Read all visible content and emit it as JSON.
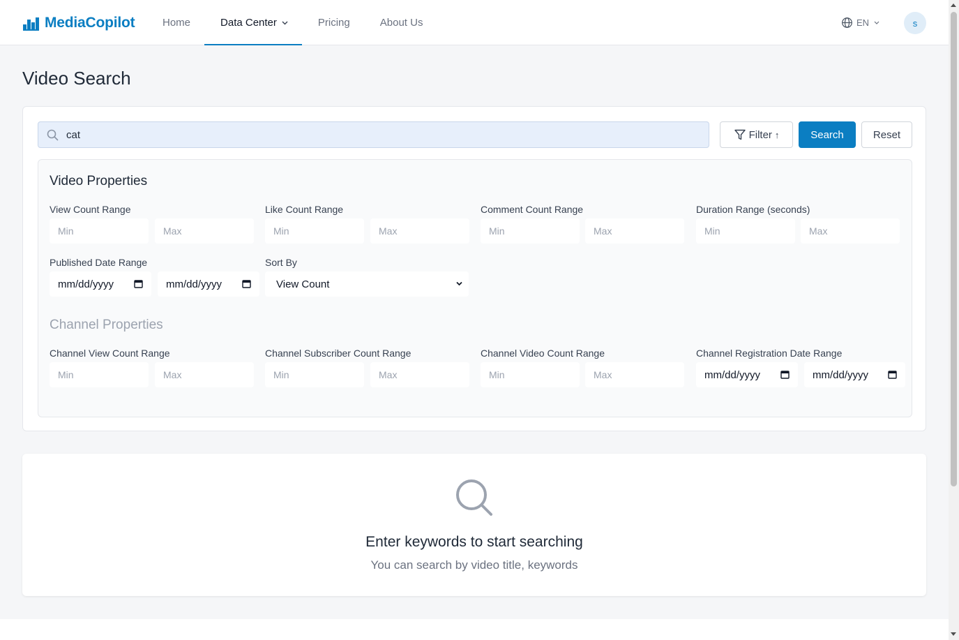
{
  "brand": {
    "name": "MediaCopilot",
    "color": "#0b7ec2"
  },
  "nav": {
    "items": [
      {
        "label": "Home",
        "active": false
      },
      {
        "label": "Data Center",
        "active": true,
        "has_dropdown": true
      },
      {
        "label": "Pricing",
        "active": false
      },
      {
        "label": "About Us",
        "active": false
      }
    ]
  },
  "header": {
    "language": "EN",
    "avatar_initial": "s"
  },
  "page": {
    "title": "Video Search"
  },
  "search": {
    "query": "cat",
    "filter_label": "Filter",
    "filter_arrow": "↑",
    "search_label": "Search",
    "reset_label": "Reset"
  },
  "video_properties": {
    "title": "Video Properties",
    "view_count": {
      "label": "View Count Range",
      "min": "Min",
      "max": "Max"
    },
    "like_count": {
      "label": "Like Count Range",
      "min": "Min",
      "max": "Max"
    },
    "comment_count": {
      "label": "Comment Count Range",
      "min": "Min",
      "max": "Max"
    },
    "duration": {
      "label": "Duration Range (seconds)",
      "min": "Min",
      "max": "Max"
    },
    "published_date": {
      "label": "Published Date Range",
      "start": "mm/dd/yyyy",
      "end": "mm/dd/yyyy"
    },
    "sort_by": {
      "label": "Sort By",
      "value": "View Count"
    }
  },
  "channel_properties": {
    "title": "Channel Properties",
    "view_count": {
      "label": "Channel View Count Range",
      "min": "Min",
      "max": "Max"
    },
    "subscriber_count": {
      "label": "Channel Subscriber Count Range",
      "min": "Min",
      "max": "Max"
    },
    "video_count": {
      "label": "Channel Video Count Range",
      "min": "Min",
      "max": "Max"
    },
    "registration_date": {
      "label": "Channel Registration Date Range",
      "start": "mm/dd/yyyy",
      "end": "mm/dd/yyyy"
    }
  },
  "empty_state": {
    "icon": "search-icon",
    "title": "Enter keywords to start searching",
    "subtitle": "You can search by video title, keywords"
  }
}
